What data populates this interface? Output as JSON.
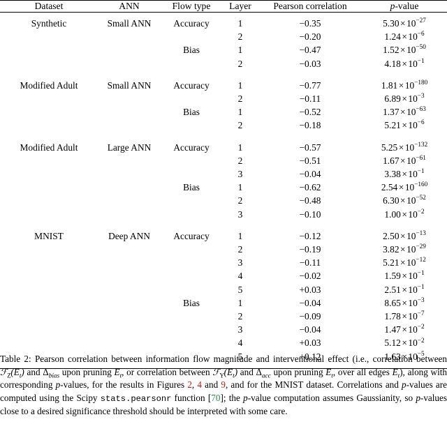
{
  "table": {
    "columns": [
      "Dataset",
      "ANN",
      "Flow type",
      "Layer",
      "Pearson correlation",
      "p-value"
    ],
    "groups": [
      {
        "dataset": "Synthetic",
        "ann": "Small ANN",
        "rows": [
          {
            "flow": "Accuracy",
            "layer": "1",
            "corr": "−0.35",
            "mant": "5.30",
            "exp": "−27"
          },
          {
            "flow": "",
            "layer": "2",
            "corr": "−0.20",
            "mant": "1.24",
            "exp": "−6"
          },
          {
            "flow": "Bias",
            "layer": "1",
            "corr": "−0.47",
            "mant": "1.52",
            "exp": "−50"
          },
          {
            "flow": "",
            "layer": "2",
            "corr": "−0.03",
            "mant": "4.18",
            "exp": "−1"
          }
        ]
      },
      {
        "dataset": "Modified Adult",
        "ann": "Small ANN",
        "rows": [
          {
            "flow": "Accuracy",
            "layer": "1",
            "corr": "−0.77",
            "mant": "1.81",
            "exp": "−180"
          },
          {
            "flow": "",
            "layer": "2",
            "corr": "−0.11",
            "mant": "6.89",
            "exp": "−3"
          },
          {
            "flow": "Bias",
            "layer": "1",
            "corr": "−0.52",
            "mant": "1.37",
            "exp": "−63"
          },
          {
            "flow": "",
            "layer": "2",
            "corr": "−0.18",
            "mant": "5.21",
            "exp": "−6"
          }
        ]
      },
      {
        "dataset": "Modified Adult",
        "ann": "Large ANN",
        "rows": [
          {
            "flow": "Accuracy",
            "layer": "1",
            "corr": "−0.57",
            "mant": "5.25",
            "exp": "−132"
          },
          {
            "flow": "",
            "layer": "2",
            "corr": "−0.51",
            "mant": "1.67",
            "exp": "−61"
          },
          {
            "flow": "",
            "layer": "3",
            "corr": "−0.04",
            "mant": "3.38",
            "exp": "−1"
          },
          {
            "flow": "Bias",
            "layer": "1",
            "corr": "−0.62",
            "mant": "2.54",
            "exp": "−160"
          },
          {
            "flow": "",
            "layer": "2",
            "corr": "−0.48",
            "mant": "6.30",
            "exp": "−52"
          },
          {
            "flow": "",
            "layer": "3",
            "corr": "−0.10",
            "mant": "1.00",
            "exp": "−2"
          }
        ]
      },
      {
        "dataset": "MNIST",
        "ann": "Deep ANN",
        "rows": [
          {
            "flow": "Accuracy",
            "layer": "1",
            "corr": "−0.12",
            "mant": "2.50",
            "exp": "−13"
          },
          {
            "flow": "",
            "layer": "2",
            "corr": "−0.19",
            "mant": "3.82",
            "exp": "−29"
          },
          {
            "flow": "",
            "layer": "3",
            "corr": "−0.11",
            "mant": "5.21",
            "exp": "−12"
          },
          {
            "flow": "",
            "layer": "4",
            "corr": "−0.02",
            "mant": "1.59",
            "exp": "−1"
          },
          {
            "flow": "",
            "layer": "5",
            "corr": "+0.03",
            "mant": "2.51",
            "exp": "−1"
          },
          {
            "flow": "Bias",
            "layer": "1",
            "corr": "−0.04",
            "mant": "8.65",
            "exp": "−3"
          },
          {
            "flow": "",
            "layer": "2",
            "corr": "−0.09",
            "mant": "1.78",
            "exp": "−7"
          },
          {
            "flow": "",
            "layer": "3",
            "corr": "−0.04",
            "mant": "1.47",
            "exp": "−2"
          },
          {
            "flow": "",
            "layer": "4",
            "corr": "+0.03",
            "mant": "5.12",
            "exp": "−2"
          },
          {
            "flow": "",
            "layer": "5",
            "corr": "+0.12",
            "mant": "1.63",
            "exp": "−5"
          }
        ]
      }
    ],
    "sci_times": "×",
    "sci_base": "10"
  },
  "caption": {
    "label": "Table 2:",
    "t1": " Pearson correlation between information flow magnitude and interventional effect (i.e., correlation between ",
    "f_z": "F",
    "f_z_sub": "Z",
    "f_arg": "(E",
    "f_arg_sub": "t",
    "f_arg_end": ")",
    "t2": " and ",
    "delta_bias": "Δ",
    "delta_bias_sub": "bias",
    "t3": " upon pruning ",
    "e1": "E",
    "e1_sub": "t",
    "t4": ", or correlation between ",
    "f_y": "F",
    "f_y_sub": "Y",
    "t5": " and ",
    "delta_acc": "Δ",
    "delta_acc_sub": "acc",
    "t6": " upon pruning ",
    "e2": "E",
    "e2_sub": "t",
    "t7": ", over all edges ",
    "e3": "E",
    "e3_sub": "t",
    "t8": "), along with corresponding ",
    "p1": "p",
    "t9": "-values, for the results in Figures ",
    "ref1": "2",
    "t10": ", ",
    "ref2": "4",
    "t11": " and ",
    "ref3": "9",
    "t12": ", and for the MNIST dataset. Correlations and ",
    "p2": "p",
    "t13": "-values are computed using the Scipy ",
    "mono": "stats.pearsonr",
    "t14": " function [",
    "bibref": "70",
    "t15": "]; the ",
    "p3": "p",
    "t16": "-value computation assumes Gaussianity, so ",
    "p4": "p",
    "t17": "-values close to a desired significance threshold should be interpreted with some care."
  }
}
